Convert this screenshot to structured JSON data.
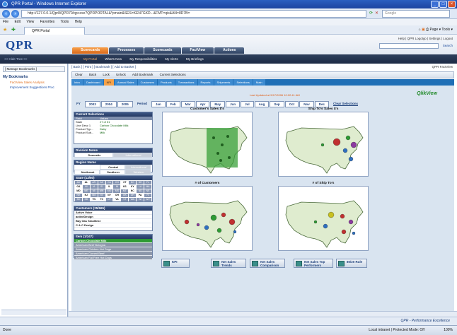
{
  "window": {
    "title": "QPR Portal - Windows Internet Explorer"
  },
  "browser": {
    "url": "http://127.0.0.1/Qpr8/QPR70/qpr.exe?QPRPORTAL&*pmain&SES=KEN7GKD...&FMT=qis&AN=8D7B=",
    "search_placeholder": "Google",
    "menu": [
      "File",
      "Edit",
      "View",
      "Favorites",
      "Tools",
      "Help"
    ],
    "tab_label": "QPR Portal",
    "tools": "Page ▾   Tools ▾"
  },
  "qpr": {
    "logo": "QPR",
    "toplinks": "Help | QPR Logotyp | Settings | Logout",
    "search_label": "Search",
    "tabs": [
      {
        "label": "Scorecards"
      },
      {
        "label": "Processes"
      },
      {
        "label": "Scorecards"
      },
      {
        "label": "FactView"
      },
      {
        "label": "Actions"
      }
    ],
    "hide_tree": "<< Hide Tree >>",
    "subnav": [
      "My Portal",
      "What's New",
      "My Responsibilities",
      "My Alerts",
      "My Briefings"
    ]
  },
  "left": {
    "manage": "[ Manage Bookmarks ]",
    "title": "My Bookmarks",
    "items": [
      "FactView Sales Analysis",
      "Improvement Suggestions Proc"
    ]
  },
  "content": {
    "crumb": "[ Back ] [ Print ] [ Bookmark ] [ Add to Basket ]",
    "crumb_right": "QPR FactView",
    "toolbar": [
      "Clear",
      "Back",
      "Lock",
      "Unlock",
      "Add Bookmark",
      "Current Selections"
    ],
    "qvtabs": [
      "Intro",
      "Dashboard",
      "KPI",
      "Annual Sales",
      "Customers",
      "Products",
      "Transactions",
      "Reports",
      "Shipments",
      "Selections",
      "Main"
    ],
    "last_update": "Last Updated at 5/17/2006 10:02:41 AM",
    "qv_logo": "QlikView",
    "fy_label": "FY",
    "years": [
      "2003",
      "2004",
      "2005"
    ],
    "period_label": "Period",
    "months": [
      "Jan",
      "Feb",
      "Mar",
      "Apr",
      "May",
      "Jun",
      "Jul",
      "Aug",
      "Sep",
      "Oct",
      "Nov",
      "Dec"
    ],
    "clear_selections": "Clear Selections"
  },
  "current_selections": {
    "title": "Current Selections",
    "head": [
      "Field",
      "Values"
    ],
    "rows": [
      {
        "field": "State",
        "value": "27 of 51"
      },
      {
        "field": "Line Desc 1",
        "value": "Carbon Chocolate Milk"
      },
      {
        "field": "Product Typ...",
        "value": "Dairy"
      },
      {
        "field": "Product Sub...",
        "value": "Milk"
      }
    ]
  },
  "division": {
    "title": "Division Name",
    "items": [
      "Domestic",
      "International"
    ]
  },
  "region": {
    "title": "Region Name",
    "items": [
      "Central",
      "International",
      "Northeast",
      "Southern",
      "Western"
    ]
  },
  "states": {
    "title": "State (13/50)",
    "items": [
      "AK",
      "AL",
      "AR",
      "AZ",
      "CA",
      "CO",
      "CT",
      "DC",
      "DE",
      "FL",
      "GA",
      "HI",
      "IA",
      "ID",
      "IL",
      "IN",
      "KS",
      "KY",
      "LA",
      "MA",
      "MD",
      "ME",
      "MI",
      "MN",
      "MO",
      "MS",
      "MT",
      "NC",
      "ND",
      "NE",
      "NH",
      "NJ",
      "NM",
      "NV",
      "NY",
      "OH",
      "OK",
      "OR",
      "PA",
      "RI",
      "SC",
      "SD",
      "TN",
      "TX",
      "UT",
      "VA",
      "VT",
      "WA",
      "WI",
      "WV"
    ],
    "selected": [
      "AL",
      "CT",
      "GA",
      "IL",
      "KS",
      "KY",
      "MD",
      "NC",
      "NJ",
      "NY",
      "OH",
      "PA",
      "TN",
      "TX",
      "VA"
    ]
  },
  "customers": {
    "title": "Customers (25/665)",
    "items": [
      "Active Voice",
      "activeDesign",
      "Bay Gas Smalltest",
      "C & C Design"
    ]
  },
  "items_list": {
    "title": "Item (1/347)",
    "items": [
      "Carbon Chocolate Milk",
      "American Beef Bologna",
      "American Chicken Hot Dogs",
      "American Corned Beef",
      "American Fat Free Hot Dogs"
    ]
  },
  "charts": [
    {
      "title": "Customer's Sales $'s"
    },
    {
      "title": "Ship To's Sales $'s"
    },
    {
      "title": "# of Customers"
    },
    {
      "title": "# of Ship To's"
    }
  ],
  "action_buttons": [
    "KPI",
    "Net Sales Trends",
    "Net Sales Comparison",
    "Net Sales Top Performers",
    "80/20 Rule"
  ],
  "footer": {
    "slogan": "QPR - Performance Excellence"
  },
  "status": {
    "left": "Done",
    "zone": "Local intranet | Protected Mode: Off",
    "zoom": "100%"
  },
  "colors": {
    "accent": "#f5a24a",
    "brand": "#1c4a9a",
    "selected": "#2e9a34"
  }
}
